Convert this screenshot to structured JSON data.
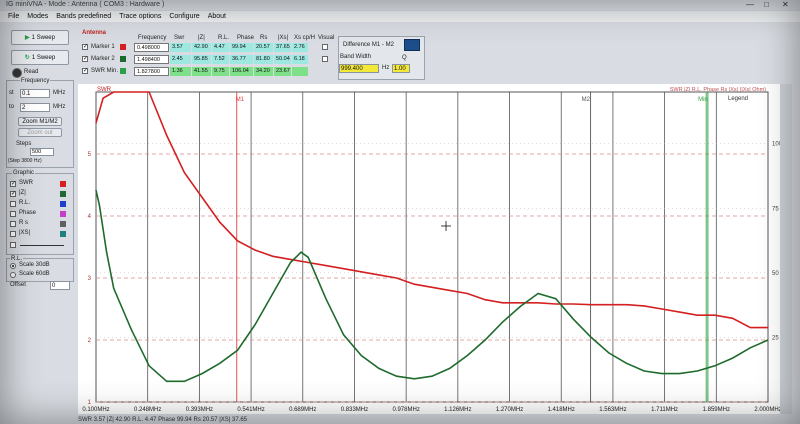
{
  "window": {
    "title": "IG miniVNA - Mode : Antenna ( COM3 : Hardware )"
  },
  "menu": [
    "File",
    "Modes",
    "Bands predefined",
    "Trace options",
    "Configure",
    "About"
  ],
  "left": {
    "sweep_single": "1 Sweep",
    "sweep_cont": "1 Sweep",
    "read": "Read",
    "frequency_title": "Frequency",
    "start_label": "st",
    "start_value": "0.1",
    "start_unit": "MHz",
    "stop_label": "to",
    "stop_value": "2",
    "stop_unit": "MHz",
    "zoom": "Zoom M1/M2",
    "zoom_out": "Zoom out",
    "steps_title": "Steps",
    "steps_value": "500",
    "step_info": "(Step 3800 Hz)",
    "graphic_title": "Graphic",
    "traces": [
      {
        "name": "SWR",
        "checked": true,
        "color": "#d42020"
      },
      {
        "name": "|Z|",
        "checked": true,
        "color": "#1f6b2d"
      },
      {
        "name": "R.L.",
        "checked": false,
        "color": "#2040c8"
      },
      {
        "name": "Phase",
        "checked": false,
        "color": "#c040c8"
      },
      {
        "name": "R s",
        "checked": false,
        "color": "#606060"
      },
      {
        "name": "|XS|",
        "checked": false,
        "color": "#208080"
      }
    ],
    "rl_title": "R.L.",
    "scale1": "Scale 30dB",
    "scale2": "Scale 60dB",
    "offset_label": "Offset",
    "offset_value": "0"
  },
  "markers": {
    "title": "Antenna",
    "headers": [
      "Frequency",
      "Swr",
      "|Z|",
      "R.L.",
      "Phase",
      "Rs",
      "|Xs|",
      "Xs  cp/H",
      "Visual"
    ],
    "rows": [
      {
        "name": "Marker 1",
        "color": "#d42020",
        "values": [
          "0.498000",
          "3.57",
          "42.90",
          "4.47",
          "99.94",
          "20.57",
          "37.65",
          "2.76"
        ]
      },
      {
        "name": "Marker 2",
        "color": "#1f6b2d",
        "values": [
          "1.498400",
          "2.45",
          "95.85",
          "7.52",
          "36.77",
          "81.80",
          "50.04",
          "6.18"
        ]
      },
      {
        "name": "SWR Min.",
        "color": "#2aa04a",
        "values": [
          "1.827800",
          "1.36",
          "41.55",
          "9.75",
          "106.04",
          "34.20",
          "23.67",
          ""
        ]
      }
    ],
    "diff_title": "Difference M1 - M2",
    "band_width_label": "Band Width",
    "band_width_value": "999.400",
    "hz_label": "Hz",
    "q_label": "Q",
    "q_value": "1.00"
  },
  "chart_data": {
    "type": "line",
    "xlabel": "",
    "xticks": [
      "0.100MHz",
      "0.248MHz",
      "0.393MHz",
      "0.541MHz",
      "0.689MHz",
      "0.833MHz",
      "0.978MHz",
      "1.126MHz",
      "1.270MHz",
      "1.418MHz",
      "1.563MHz",
      "1.711MHz",
      "1.859MHz",
      "2.000MHz"
    ],
    "yticks_left": [
      "1",
      "2",
      "3",
      "4",
      "5"
    ],
    "yticks_right": [
      "25",
      "50",
      "75",
      "100"
    ],
    "top_left_label": "SWR",
    "top_right_label": "SWR  |Z|  R.L.  Phase  Rs  |Xs|  (|Xs|  Ohm)",
    "legend_label": "Legend",
    "marker_labels": [
      "M1",
      "M2",
      "Min"
    ],
    "marker_x": [
      0.498,
      1.4984,
      1.8278
    ],
    "x_range": [
      0.1,
      2.0
    ],
    "series": [
      {
        "name": "SWR",
        "color": "#d42020",
        "x": [
          0.1,
          0.12,
          0.15,
          0.2,
          0.25,
          0.3,
          0.35,
          0.4,
          0.45,
          0.5,
          0.55,
          0.6,
          0.65,
          0.7,
          0.75,
          0.8,
          0.85,
          0.9,
          0.95,
          1.0,
          1.05,
          1.1,
          1.15,
          1.2,
          1.25,
          1.3,
          1.35,
          1.4,
          1.45,
          1.5,
          1.55,
          1.6,
          1.65,
          1.7,
          1.75,
          1.8,
          1.85,
          1.9,
          1.95,
          2.0
        ],
        "y": [
          5.5,
          5.9,
          6.0,
          6.0,
          6.0,
          5.3,
          4.7,
          4.3,
          3.9,
          3.6,
          3.45,
          3.35,
          3.3,
          3.25,
          3.2,
          3.15,
          3.1,
          3.05,
          3.0,
          2.9,
          2.85,
          2.8,
          2.75,
          2.65,
          2.6,
          2.6,
          2.6,
          2.58,
          2.58,
          2.57,
          2.57,
          2.57,
          2.55,
          2.5,
          2.45,
          2.4,
          2.4,
          2.35,
          2.2,
          2.2
        ]
      },
      {
        "name": "|Z|",
        "color": "#1f6b2d",
        "x": [
          0.1,
          0.11,
          0.13,
          0.15,
          0.2,
          0.25,
          0.3,
          0.35,
          0.4,
          0.45,
          0.5,
          0.55,
          0.6,
          0.65,
          0.68,
          0.7,
          0.75,
          0.8,
          0.85,
          0.9,
          0.95,
          1.0,
          1.05,
          1.1,
          1.15,
          1.2,
          1.25,
          1.3,
          1.35,
          1.4,
          1.45,
          1.5,
          1.55,
          1.6,
          1.65,
          1.7,
          1.75,
          1.8,
          1.85,
          1.9,
          1.95,
          2.0
        ],
        "y": [
          82,
          76,
          58,
          44,
          28,
          14,
          8,
          8,
          11,
          15,
          20,
          30,
          42,
          54,
          58,
          56,
          40,
          26,
          18,
          13,
          10,
          9,
          10,
          13,
          18,
          24,
          31,
          37,
          42,
          40,
          32,
          25,
          19,
          15,
          12,
          11,
          11,
          12,
          14,
          17,
          21,
          24
        ]
      }
    ],
    "y_left_range": [
      1,
      6
    ],
    "y_right_range": [
      0,
      120
    ]
  },
  "status": {
    "text": "SWR 3.57   |Z| 42.90   R.L. 4.47   Phase 99.94   Rs 20.57   |XS| 37.65"
  }
}
